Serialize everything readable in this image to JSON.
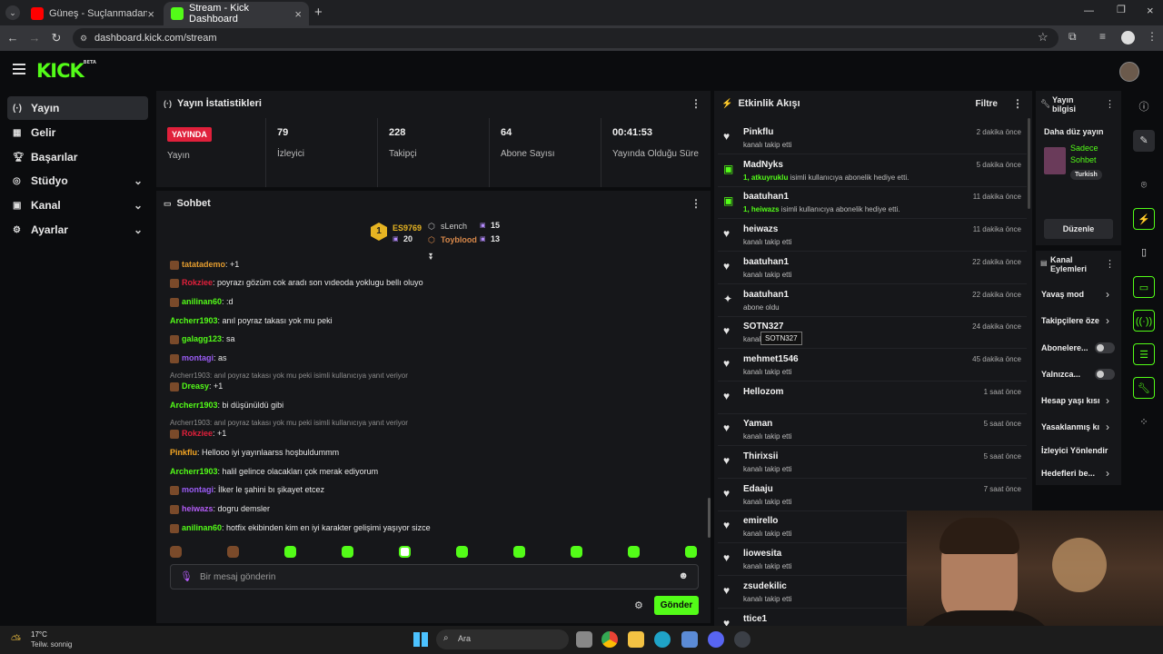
{
  "browser": {
    "tabs": [
      {
        "title": "Güneş - Suçlanmadan Biri (Offici",
        "active": false
      },
      {
        "title": "Stream - Kick Dashboard",
        "active": true
      }
    ],
    "url": "dashboard.kick.com/stream"
  },
  "site": {
    "logo": "KICK",
    "logo_beta": "BETA"
  },
  "nav": {
    "items": [
      {
        "label": "Yayın",
        "icon": "broadcast-icon",
        "active": true
      },
      {
        "label": "Gelir",
        "icon": "revenue-icon"
      },
      {
        "label": "Başarılar",
        "icon": "trophy-icon"
      },
      {
        "label": "Stüdyo",
        "icon": "studio-icon",
        "chevron": true
      },
      {
        "label": "Kanal",
        "icon": "channel-icon",
        "chevron": true
      },
      {
        "label": "Ayarlar",
        "icon": "gear-icon",
        "chevron": true
      }
    ]
  },
  "stats": {
    "title": "Yayın İstatistikleri",
    "status_badge": "YAYINDA",
    "status_label": "Yayın",
    "items": [
      {
        "value": "79",
        "label": "İzleyici"
      },
      {
        "value": "228",
        "label": "Takipçi"
      },
      {
        "value": "64",
        "label": "Abone Sayısı"
      },
      {
        "value": "00:41:53",
        "label": "Yayında Olduğu Süre"
      }
    ]
  },
  "chat": {
    "title": "Sohbet",
    "leaderboard": {
      "rank": "1",
      "top_user": "ES9769",
      "top_count": "20",
      "second_user": "sLench",
      "second_count": "15",
      "third_user": "Toyblood",
      "third_count": "13"
    },
    "messages": [
      {
        "user": "tatatademo",
        "text": ": +1",
        "color": "#e29b2f"
      },
      {
        "user": "Rokziee",
        "text": ": poyrazı gözüm cok aradı son vıdeoda yoklugu bellı oluyo",
        "color": "#e0203b"
      },
      {
        "user": "anilinan60",
        "text": ": :d",
        "color": "#53fc18"
      },
      {
        "user": "Archerr1903",
        "text": ": anıl poyraz takası yok mu peki",
        "color": "#53fc18"
      },
      {
        "user": "galagg123",
        "text": ": sa",
        "color": "#53fc18"
      },
      {
        "user": "montagi",
        "text": ": as",
        "color": "#9b5cf6"
      },
      {
        "reply": "Archerr1903: anıl poyraz takası yok mu peki isimli kullanıcıya yanıt veriyor"
      },
      {
        "user": "Dreasy",
        "text": ": +1",
        "color": "#53fc18"
      },
      {
        "user": "Archerr1903",
        "text": ": bi düşünüldü gibi",
        "color": "#53fc18"
      },
      {
        "reply": "Archerr1903: anıl poyraz takası yok mu peki isimli kullanıcıya yanıt veriyor"
      },
      {
        "user": "Rokziee",
        "text": ": +1",
        "color": "#e0203b"
      },
      {
        "user": "Pinkflu",
        "text": ": Hellooo iyi yayınlaarss hoşbuldummm",
        "color": "#f5a623"
      },
      {
        "user": "Archerr1903",
        "text": ": halil gelince olacakları çok merak ediyorum",
        "color": "#53fc18"
      },
      {
        "user": "montagi",
        "text": ": İlker le şahini bı şikayet etcez",
        "color": "#9b5cf6"
      },
      {
        "user": "heiwazs",
        "text": ": dogru demsler",
        "color": "#b35cf6"
      },
      {
        "user": "anilinan60",
        "text": ": hotfix ekibinden kim en iyi karakter gelişimi yaşıyor sizce",
        "color": "#53fc18"
      }
    ],
    "input_placeholder": "Bir mesaj gönderin",
    "send_label": "Gönder"
  },
  "activity": {
    "title": "Etkinlik Akışı",
    "filter_label": "Filtre",
    "items": [
      {
        "name": "Pinkflu",
        "sub": "kanalı takip etti",
        "time": "2 dakika önce",
        "icon": "heart-icon"
      },
      {
        "name": "MadNyks",
        "sub_prefix": "1, atkuyruklu",
        "sub": " isimli kullanıcıya abonelik hediye etti.",
        "time": "5 dakika önce",
        "icon": "gift-icon"
      },
      {
        "name": "baatuhan1",
        "sub_prefix": "1, heiwazs",
        "sub": " isimli kullanıcıya abonelik hediye etti.",
        "time": "11 dakika önce",
        "icon": "gift-icon"
      },
      {
        "name": "heiwazs",
        "sub": "kanalı takip etti",
        "time": "11 dakika önce",
        "icon": "heart-icon"
      },
      {
        "name": "baatuhan1",
        "sub": "kanalı takip etti",
        "time": "22 dakika önce",
        "icon": "heart-icon"
      },
      {
        "name": "baatuhan1",
        "sub": "abone oldu",
        "time": "22 dakika önce",
        "icon": "sparkle-icon"
      },
      {
        "name": "SOTN327",
        "sub": "kanalı takip etti",
        "time": "24 dakika önce",
        "icon": "heart-icon"
      },
      {
        "name": "mehmet1546",
        "sub": "kanalı takip etti",
        "time": "45 dakika önce",
        "icon": "heart-icon"
      },
      {
        "name": "Hellozom",
        "sub": "",
        "time": "1 saat önce",
        "icon": "heart-icon"
      },
      {
        "name": "Yaman",
        "sub": "kanalı takip etti",
        "time": "5 saat önce",
        "icon": "heart-icon"
      },
      {
        "name": "Thirixsii",
        "sub": "kanalı takip etti",
        "time": "5 saat önce",
        "icon": "heart-icon"
      },
      {
        "name": "Edaaju",
        "sub": "kanalı takip etti",
        "time": "7 saat önce",
        "icon": "heart-icon"
      },
      {
        "name": "emirello",
        "sub": "kanalı takip etti",
        "time": "",
        "icon": "heart-icon"
      },
      {
        "name": "liowesita",
        "sub": "kanalı takip etti",
        "time": "",
        "icon": "heart-icon"
      },
      {
        "name": "zsudekilic",
        "sub": "kanalı takip etti",
        "time": "",
        "icon": "heart-icon"
      },
      {
        "name": "ttice1",
        "sub": "",
        "time": "",
        "icon": "heart-icon"
      }
    ],
    "tooltip": "SOTN327"
  },
  "stream_info": {
    "title": "Yayın bilgisi",
    "stream_title": "Daha düz yayın",
    "category": "Sadece Sohbet",
    "tag": "Turkish",
    "edit_label": "Düzenle"
  },
  "channel_actions": {
    "title": "Kanal Eylemleri",
    "items": [
      {
        "label": "Yavaş mod",
        "control": "chevron"
      },
      {
        "label": "Takipçilere öze",
        "control": "chevron"
      },
      {
        "label": "Abonelere...",
        "control": "toggle"
      },
      {
        "label": "Yalnızca...",
        "control": "toggle"
      },
      {
        "label": "Hesap yaşı kısı",
        "control": "chevron"
      },
      {
        "label": "Yasaklanmış kı",
        "control": "chevron"
      },
      {
        "label": "İzleyici Yönlendir",
        "control": "none"
      },
      {
        "label": "Hedefleri be...",
        "control": "chevron"
      }
    ]
  },
  "taskbar": {
    "weather_temp": "17°C",
    "weather_desc": "Teilw. sonnig",
    "search_label": "Ara"
  }
}
